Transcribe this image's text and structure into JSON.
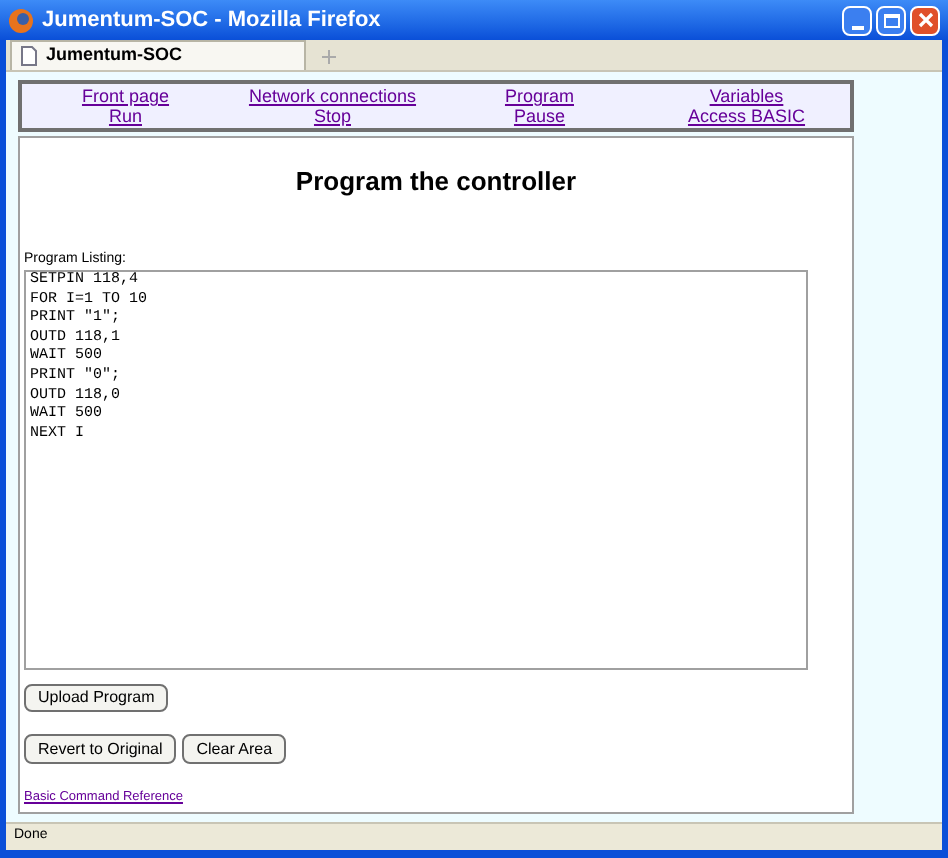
{
  "window": {
    "title": "Jumentum-SOC - Mozilla Firefox"
  },
  "tabs": [
    {
      "label": "Jumentum-SOC",
      "selected": true
    }
  ],
  "nav": [
    {
      "label": "Front page"
    },
    {
      "label": "Network connections"
    },
    {
      "label": "Program"
    },
    {
      "label": "Variables"
    },
    {
      "label": "Run"
    },
    {
      "label": "Stop"
    },
    {
      "label": "Pause"
    },
    {
      "label": "Access BASIC"
    }
  ],
  "heading": "Program the controller",
  "listing_label": "Program Listing:",
  "listing": [
    "SETPIN 118,4",
    "FOR I=1 TO 10",
    "PRINT \"1\";",
    "OUTD 118,1",
    "WAIT 500",
    "PRINT \"0\";",
    "OUTD 118,0",
    "WAIT 500",
    "NEXT I"
  ],
  "upload_button": "Upload Program",
  "buttons": [
    "Revert to Original",
    "Clear Area"
  ],
  "reference_link": "Basic Command Reference",
  "status_bar": "Done"
}
